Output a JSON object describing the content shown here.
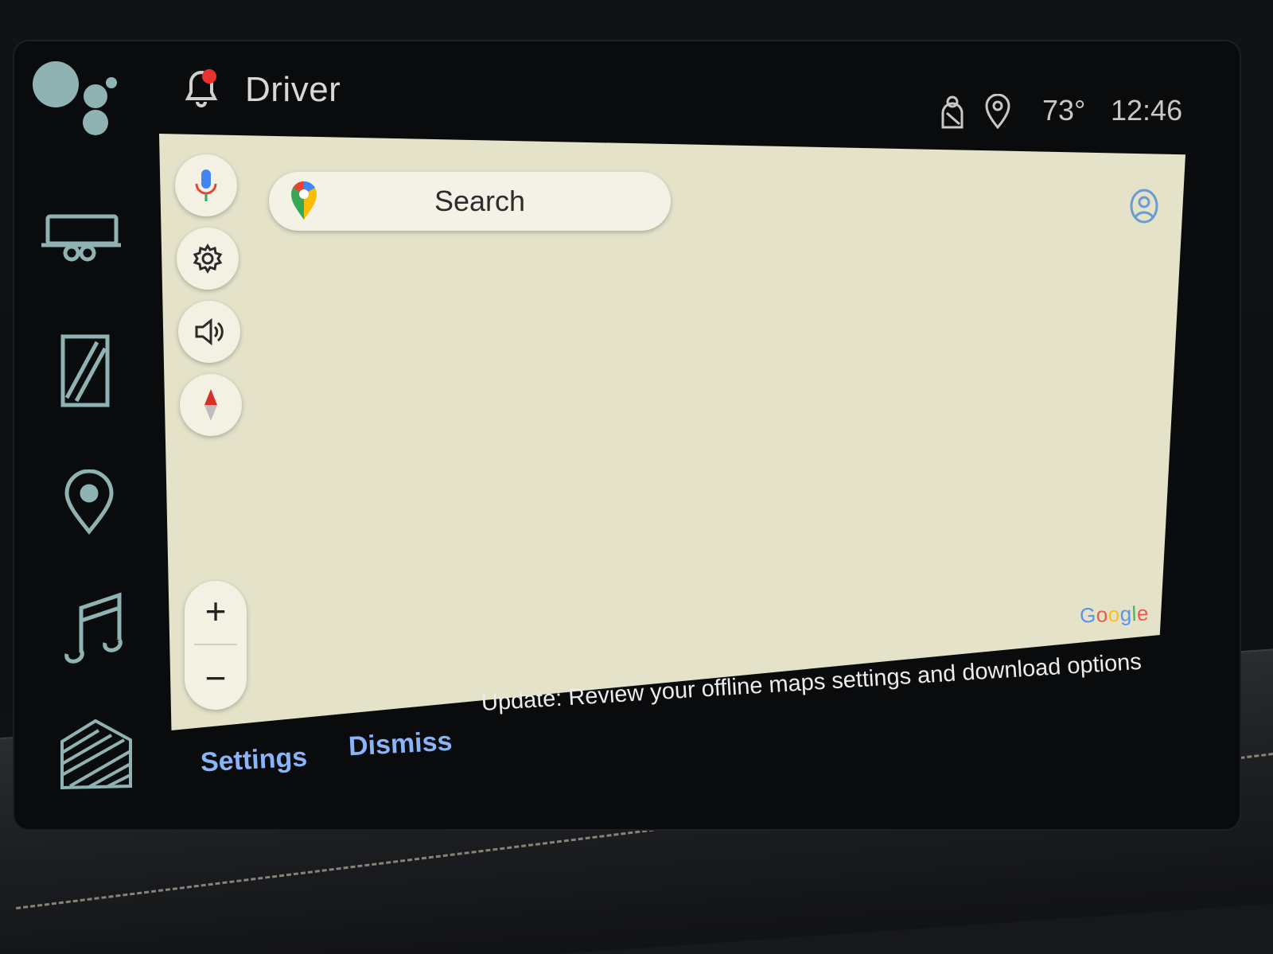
{
  "status_bar": {
    "notification_label": "Driver",
    "temperature": "73°",
    "time": "12:46"
  },
  "rail": {
    "items": [
      {
        "icon": "google-assistant-icon"
      },
      {
        "icon": "vehicle-trailer-icon"
      },
      {
        "icon": "split-screen-icon"
      },
      {
        "icon": "location-pin-icon"
      },
      {
        "icon": "music-note-icon"
      },
      {
        "icon": "building-icon"
      }
    ]
  },
  "map": {
    "search": {
      "label": "Search"
    },
    "controls": [
      {
        "icon": "microphone-icon"
      },
      {
        "icon": "gear-icon"
      },
      {
        "icon": "speaker-icon"
      },
      {
        "icon": "compass-icon"
      }
    ],
    "zoom": {
      "in": "+",
      "out": "−"
    },
    "watermark": {
      "letters": [
        "G",
        "o",
        "o",
        "g",
        "l",
        "e"
      ]
    },
    "colors": {
      "background": "#e4e2c8",
      "accent_blue": "#8ab4f8",
      "google_blue": "#4285f4",
      "google_red": "#ea4335",
      "google_yellow": "#fbbc05",
      "google_green": "#34a853"
    }
  },
  "snackbar": {
    "settings_label": "Settings",
    "dismiss_label": "Dismiss",
    "message": "Update: Review your offline maps settings and download options"
  }
}
